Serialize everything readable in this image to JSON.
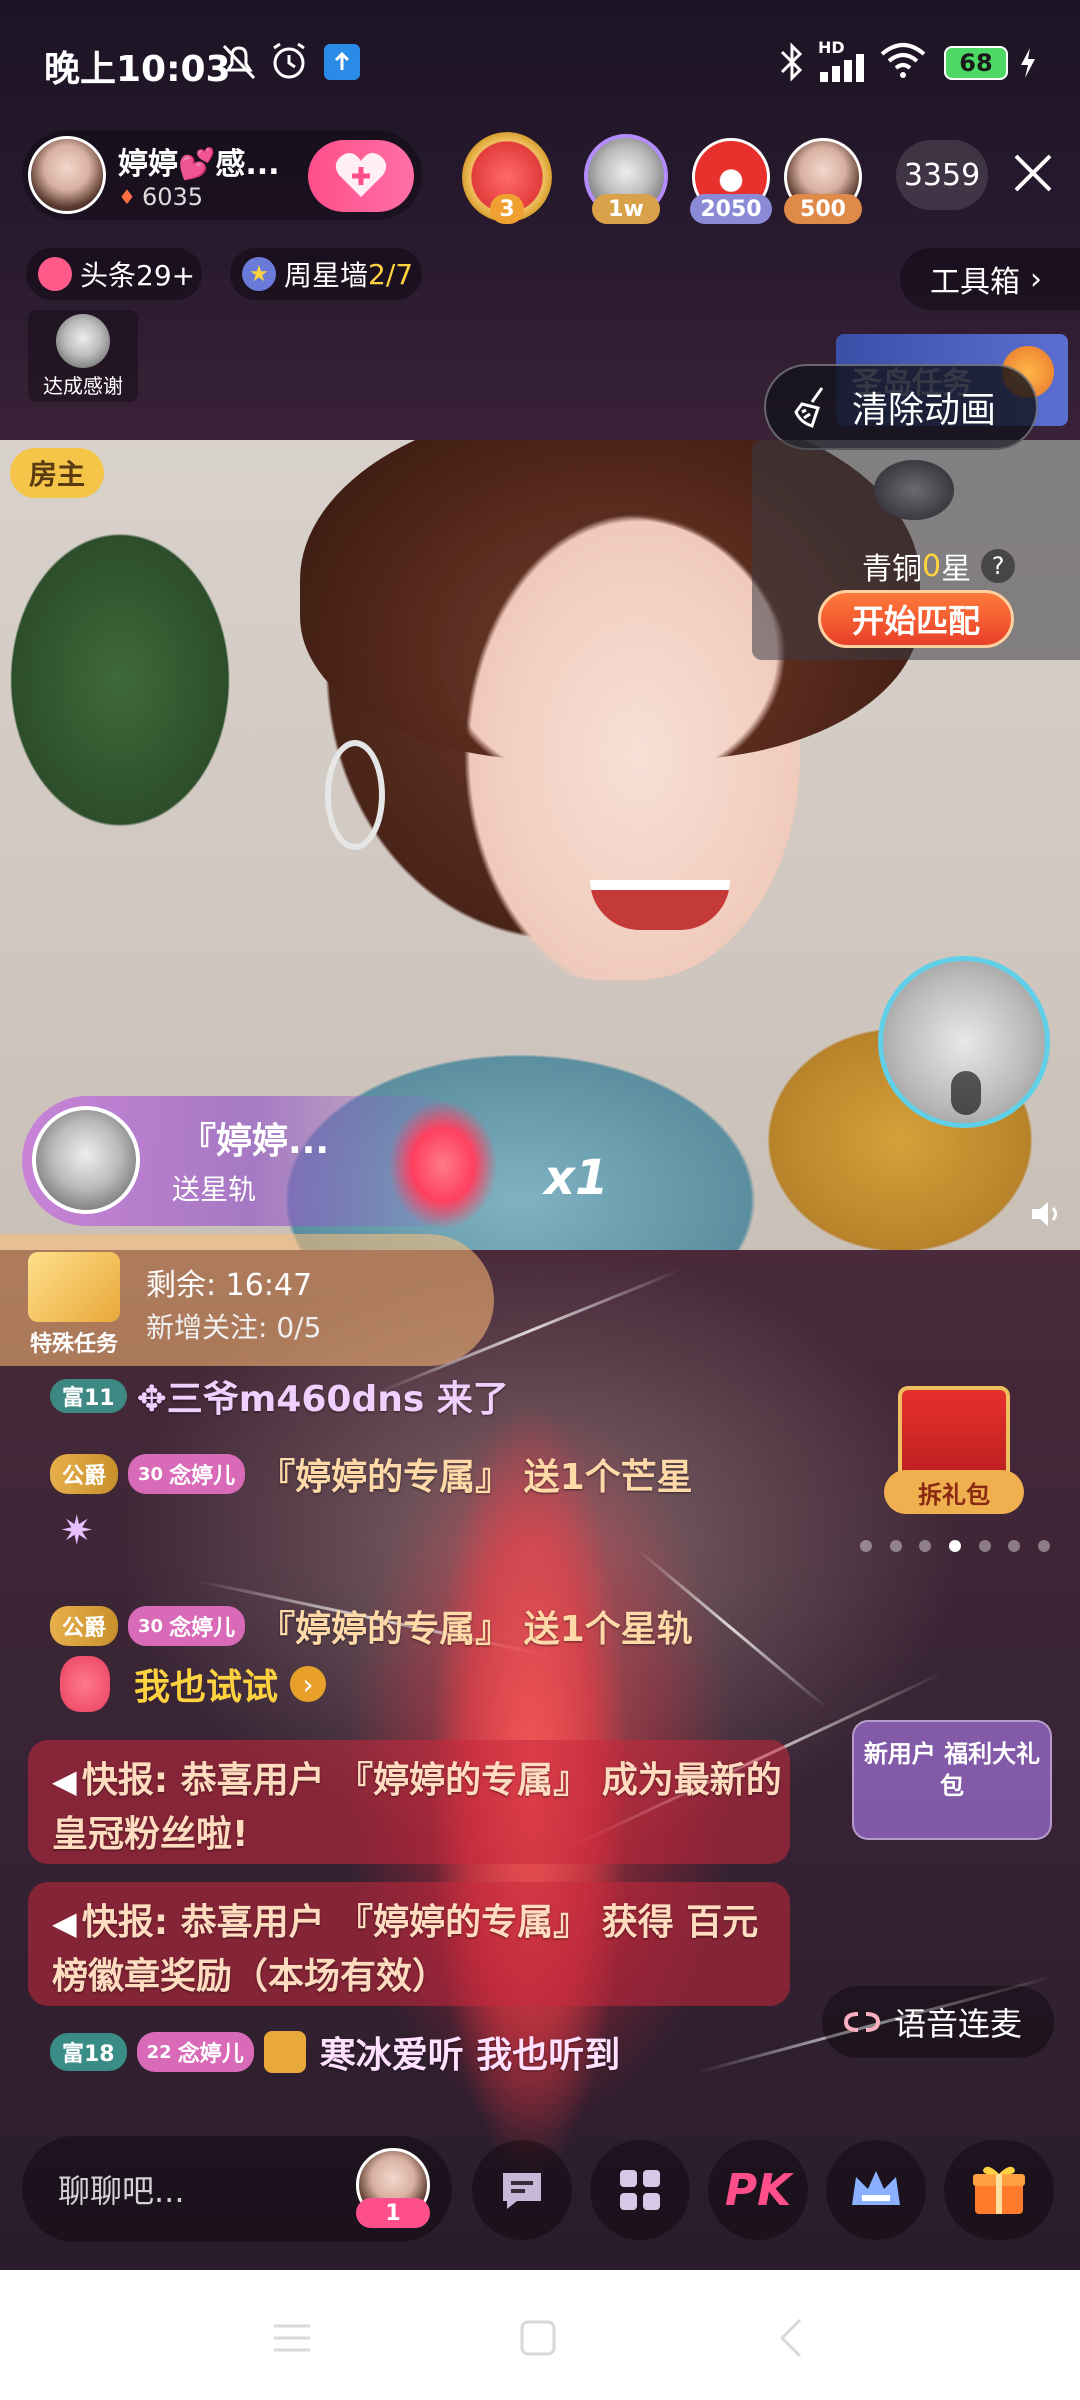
{
  "status_bar": {
    "time": "晚上10:03",
    "battery": "68",
    "net_label": "HD"
  },
  "host": {
    "name": "婷婷💕感...",
    "heat": "6035"
  },
  "top_viewers": {
    "ranks": [
      "3",
      "1w",
      "2050",
      "500"
    ],
    "count": "3359"
  },
  "pills": {
    "headline": "头条29+",
    "weekly_star_prefix": "周星墙",
    "weekly_star_value": "2/7",
    "toolbox": "工具箱"
  },
  "thanks_label": "达成感谢",
  "task_banner": "圣岛任务",
  "clear_animation": "清除动画",
  "room_owner": "房主",
  "rank_panel": {
    "tier_prefix": "青铜",
    "tier_value": "0",
    "tier_suffix": "星",
    "match_button": "开始匹配"
  },
  "gift_toast": {
    "name": "『婷婷...",
    "action": "送星轨",
    "count": "x1"
  },
  "special_task": {
    "label": "特殊任务",
    "remaining": "剩余: 16:47",
    "followers": "新增关注: 0/5"
  },
  "chat": [
    {
      "badge": "富11",
      "text": "✥三爷m460dns 来了"
    },
    {
      "badge1": "公爵",
      "badge2_num": "30",
      "badge2": "念婷儿",
      "text": "『婷婷的专属』 送1个芒星"
    },
    {
      "badge1": "公爵",
      "badge2_num": "30",
      "badge2": "念婷儿",
      "text": "『婷婷的专属』 送1个星轨"
    },
    {
      "text": "我也试试"
    },
    {
      "text": "快报: 恭喜用户 『婷婷的专属』 成为最新的皇冠粉丝啦!"
    },
    {
      "text": "快报: 恭喜用户 『婷婷的专属』 获得 百元榜徽章奖励（本场有效）"
    },
    {
      "badge": "富18",
      "badge2_num": "22",
      "badge2": "念婷儿",
      "text": "寒冰爱听 我也听到"
    }
  ],
  "gift_box": "拆礼包",
  "new_user": "新用户 福利大礼包",
  "voice_link": "语音连麦",
  "bottom_bar": {
    "placeholder": "聊聊吧...",
    "mic_count": "1",
    "pk": "PK"
  },
  "colors": {
    "accent_pink": "#ff4f8b",
    "accent_orange": "#ff6a2a",
    "chat_gold": "#ffd9a8",
    "weekly_yellow": "#ffd23f"
  }
}
